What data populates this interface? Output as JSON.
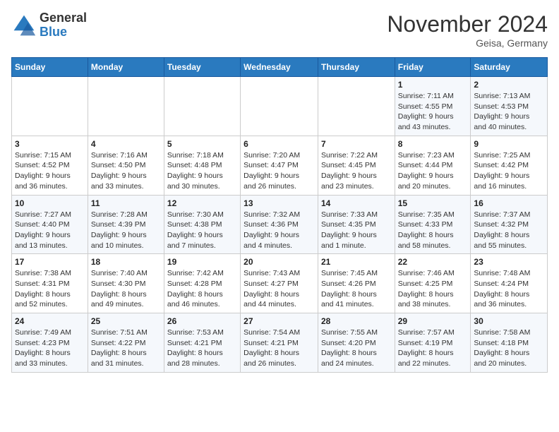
{
  "header": {
    "logo_line1": "General",
    "logo_line2": "Blue",
    "month": "November 2024",
    "location": "Geisa, Germany"
  },
  "weekdays": [
    "Sunday",
    "Monday",
    "Tuesday",
    "Wednesday",
    "Thursday",
    "Friday",
    "Saturday"
  ],
  "weeks": [
    [
      {
        "day": "",
        "info": ""
      },
      {
        "day": "",
        "info": ""
      },
      {
        "day": "",
        "info": ""
      },
      {
        "day": "",
        "info": ""
      },
      {
        "day": "",
        "info": ""
      },
      {
        "day": "1",
        "info": "Sunrise: 7:11 AM\nSunset: 4:55 PM\nDaylight: 9 hours\nand 43 minutes."
      },
      {
        "day": "2",
        "info": "Sunrise: 7:13 AM\nSunset: 4:53 PM\nDaylight: 9 hours\nand 40 minutes."
      }
    ],
    [
      {
        "day": "3",
        "info": "Sunrise: 7:15 AM\nSunset: 4:52 PM\nDaylight: 9 hours\nand 36 minutes."
      },
      {
        "day": "4",
        "info": "Sunrise: 7:16 AM\nSunset: 4:50 PM\nDaylight: 9 hours\nand 33 minutes."
      },
      {
        "day": "5",
        "info": "Sunrise: 7:18 AM\nSunset: 4:48 PM\nDaylight: 9 hours\nand 30 minutes."
      },
      {
        "day": "6",
        "info": "Sunrise: 7:20 AM\nSunset: 4:47 PM\nDaylight: 9 hours\nand 26 minutes."
      },
      {
        "day": "7",
        "info": "Sunrise: 7:22 AM\nSunset: 4:45 PM\nDaylight: 9 hours\nand 23 minutes."
      },
      {
        "day": "8",
        "info": "Sunrise: 7:23 AM\nSunset: 4:44 PM\nDaylight: 9 hours\nand 20 minutes."
      },
      {
        "day": "9",
        "info": "Sunrise: 7:25 AM\nSunset: 4:42 PM\nDaylight: 9 hours\nand 16 minutes."
      }
    ],
    [
      {
        "day": "10",
        "info": "Sunrise: 7:27 AM\nSunset: 4:40 PM\nDaylight: 9 hours\nand 13 minutes."
      },
      {
        "day": "11",
        "info": "Sunrise: 7:28 AM\nSunset: 4:39 PM\nDaylight: 9 hours\nand 10 minutes."
      },
      {
        "day": "12",
        "info": "Sunrise: 7:30 AM\nSunset: 4:38 PM\nDaylight: 9 hours\nand 7 minutes."
      },
      {
        "day": "13",
        "info": "Sunrise: 7:32 AM\nSunset: 4:36 PM\nDaylight: 9 hours\nand 4 minutes."
      },
      {
        "day": "14",
        "info": "Sunrise: 7:33 AM\nSunset: 4:35 PM\nDaylight: 9 hours\nand 1 minute."
      },
      {
        "day": "15",
        "info": "Sunrise: 7:35 AM\nSunset: 4:33 PM\nDaylight: 8 hours\nand 58 minutes."
      },
      {
        "day": "16",
        "info": "Sunrise: 7:37 AM\nSunset: 4:32 PM\nDaylight: 8 hours\nand 55 minutes."
      }
    ],
    [
      {
        "day": "17",
        "info": "Sunrise: 7:38 AM\nSunset: 4:31 PM\nDaylight: 8 hours\nand 52 minutes."
      },
      {
        "day": "18",
        "info": "Sunrise: 7:40 AM\nSunset: 4:30 PM\nDaylight: 8 hours\nand 49 minutes."
      },
      {
        "day": "19",
        "info": "Sunrise: 7:42 AM\nSunset: 4:28 PM\nDaylight: 8 hours\nand 46 minutes."
      },
      {
        "day": "20",
        "info": "Sunrise: 7:43 AM\nSunset: 4:27 PM\nDaylight: 8 hours\nand 44 minutes."
      },
      {
        "day": "21",
        "info": "Sunrise: 7:45 AM\nSunset: 4:26 PM\nDaylight: 8 hours\nand 41 minutes."
      },
      {
        "day": "22",
        "info": "Sunrise: 7:46 AM\nSunset: 4:25 PM\nDaylight: 8 hours\nand 38 minutes."
      },
      {
        "day": "23",
        "info": "Sunrise: 7:48 AM\nSunset: 4:24 PM\nDaylight: 8 hours\nand 36 minutes."
      }
    ],
    [
      {
        "day": "24",
        "info": "Sunrise: 7:49 AM\nSunset: 4:23 PM\nDaylight: 8 hours\nand 33 minutes."
      },
      {
        "day": "25",
        "info": "Sunrise: 7:51 AM\nSunset: 4:22 PM\nDaylight: 8 hours\nand 31 minutes."
      },
      {
        "day": "26",
        "info": "Sunrise: 7:53 AM\nSunset: 4:21 PM\nDaylight: 8 hours\nand 28 minutes."
      },
      {
        "day": "27",
        "info": "Sunrise: 7:54 AM\nSunset: 4:21 PM\nDaylight: 8 hours\nand 26 minutes."
      },
      {
        "day": "28",
        "info": "Sunrise: 7:55 AM\nSunset: 4:20 PM\nDaylight: 8 hours\nand 24 minutes."
      },
      {
        "day": "29",
        "info": "Sunrise: 7:57 AM\nSunset: 4:19 PM\nDaylight: 8 hours\nand 22 minutes."
      },
      {
        "day": "30",
        "info": "Sunrise: 7:58 AM\nSunset: 4:18 PM\nDaylight: 8 hours\nand 20 minutes."
      }
    ]
  ]
}
